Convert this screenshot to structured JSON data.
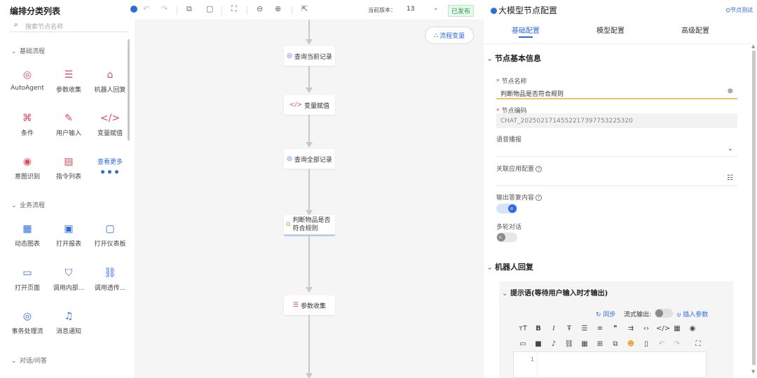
{
  "sidebar": {
    "title": "编排分类列表",
    "search_placeholder": "搜索节点名称",
    "categories": [
      {
        "name": "基础流程",
        "tools": [
          "AutoAgent",
          "参数收集",
          "机器人回复",
          "条件",
          "用户输入",
          "变量赋值",
          "意图识别",
          "指令列表"
        ],
        "more_label": "查看更多"
      },
      {
        "name": "业务流程",
        "tools": [
          "动态图表",
          "打开报表",
          "打开仪表板",
          "打开页面",
          "调用内部...",
          "调用透传...",
          "事务处理流",
          "消息通知"
        ]
      },
      {
        "name": "对话/问答"
      }
    ]
  },
  "toolbar": {
    "version_label": "当前版本：",
    "version_value": "13",
    "status_badge": "已发布"
  },
  "canvas": {
    "flow_var_button": "流程变量",
    "nodes": [
      "查询当前记录",
      "变量赋值",
      "查询全部记录",
      "判断物品是否符合规则",
      "参数收集"
    ]
  },
  "panel": {
    "title": "大模型节点配置",
    "test_button": "节点测试",
    "tabs": [
      "基础配置",
      "模型配置",
      "高级配置"
    ],
    "section_basic": "节点基本信息",
    "node_name_label": "节点名称",
    "node_name_value": "判断物品是否符合规则",
    "node_code_label": "节点编码",
    "node_code_value": "CHAT_2025021714552217397753225320",
    "voice_label": "语音播报",
    "app_config_label": "关联应用配置",
    "output_reply_label": "输出答复内容",
    "output_reply_on": true,
    "multi_turn_label": "多轮对话",
    "multi_turn_on": false,
    "section_robot": "机器人回复",
    "prompt_section": "提示语(等待用户输入时才输出)",
    "sync_label": "同步",
    "stream_label": "流式输出:",
    "insert_param_label": "插入参数",
    "editor_line_number": "1"
  },
  "colors": {
    "accent": "#2f6bdf",
    "tool_icon": "#e24a5a",
    "published": "#2a9b45"
  }
}
